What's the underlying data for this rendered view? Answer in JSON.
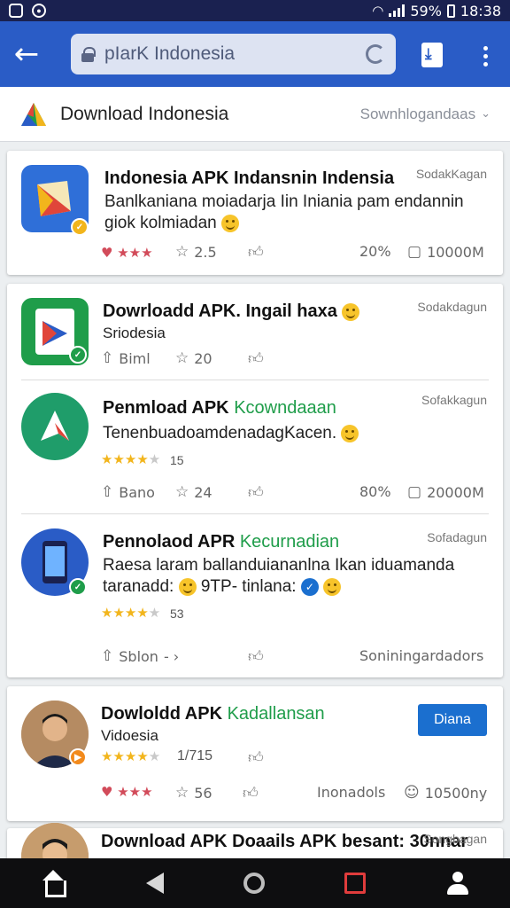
{
  "status_bar": {
    "battery": "59%",
    "time": "18:38"
  },
  "browser": {
    "url": "pIarK Indonesia"
  },
  "header": {
    "title": "Download Indonesia",
    "sort_label": "Sownhlogandaas"
  },
  "apps": [
    {
      "name": "Indonesia APK Indansnin Indensia",
      "date": "SodakKagan",
      "desc": "Banlkaniana moiadarja Iin Iniania pam endannin giok kolmiadan",
      "rating_count": "2.5",
      "meta_left": "",
      "percent": "20%",
      "downloads": "10000M"
    },
    {
      "name": "Dowrloadd APK. Ingail haxa",
      "date": "Sodakdagun",
      "desc": "Sriodesia",
      "meta_left": "Biml",
      "rating_count": "20"
    },
    {
      "name_main": "Penmload APK",
      "name_green": "Kcowndaaan",
      "date": "Sofakkagun",
      "desc": "TenenbuadoamdenadagKacen.",
      "stars_num": "15",
      "meta_left": "Bano",
      "rating_count": "24",
      "percent": "80%",
      "downloads": "20000M"
    },
    {
      "name_main": "Pennolaod APR",
      "name_green": "Kecurnadian",
      "date": "Sofadagun",
      "desc_line1": "Raesa laram ballanduiananlna Ikan iduamanda",
      "desc_line2": "taranadd:",
      "desc_extra": "9TP- tinlana:",
      "stars_num": "53",
      "meta_left": "Sblon",
      "meta_right": "Soniningardadors"
    },
    {
      "name_main": "Dowloldd APK",
      "name_green": "Kadallansan",
      "desc": "Vidoesia",
      "stars_num": "1/715",
      "button": "Diana",
      "rating_count": "56",
      "downloads_label": "Inonadols",
      "downloads": "10500ny"
    },
    {
      "name": "Download APK Doaails APK besant: 30nnar",
      "date": "Songbagan"
    }
  ],
  "colors": {
    "toolbar": "#2a5cc6",
    "status_bar": "#1a2150",
    "accent_green": "#1f9d4a",
    "button_blue": "#1b6fcf"
  }
}
